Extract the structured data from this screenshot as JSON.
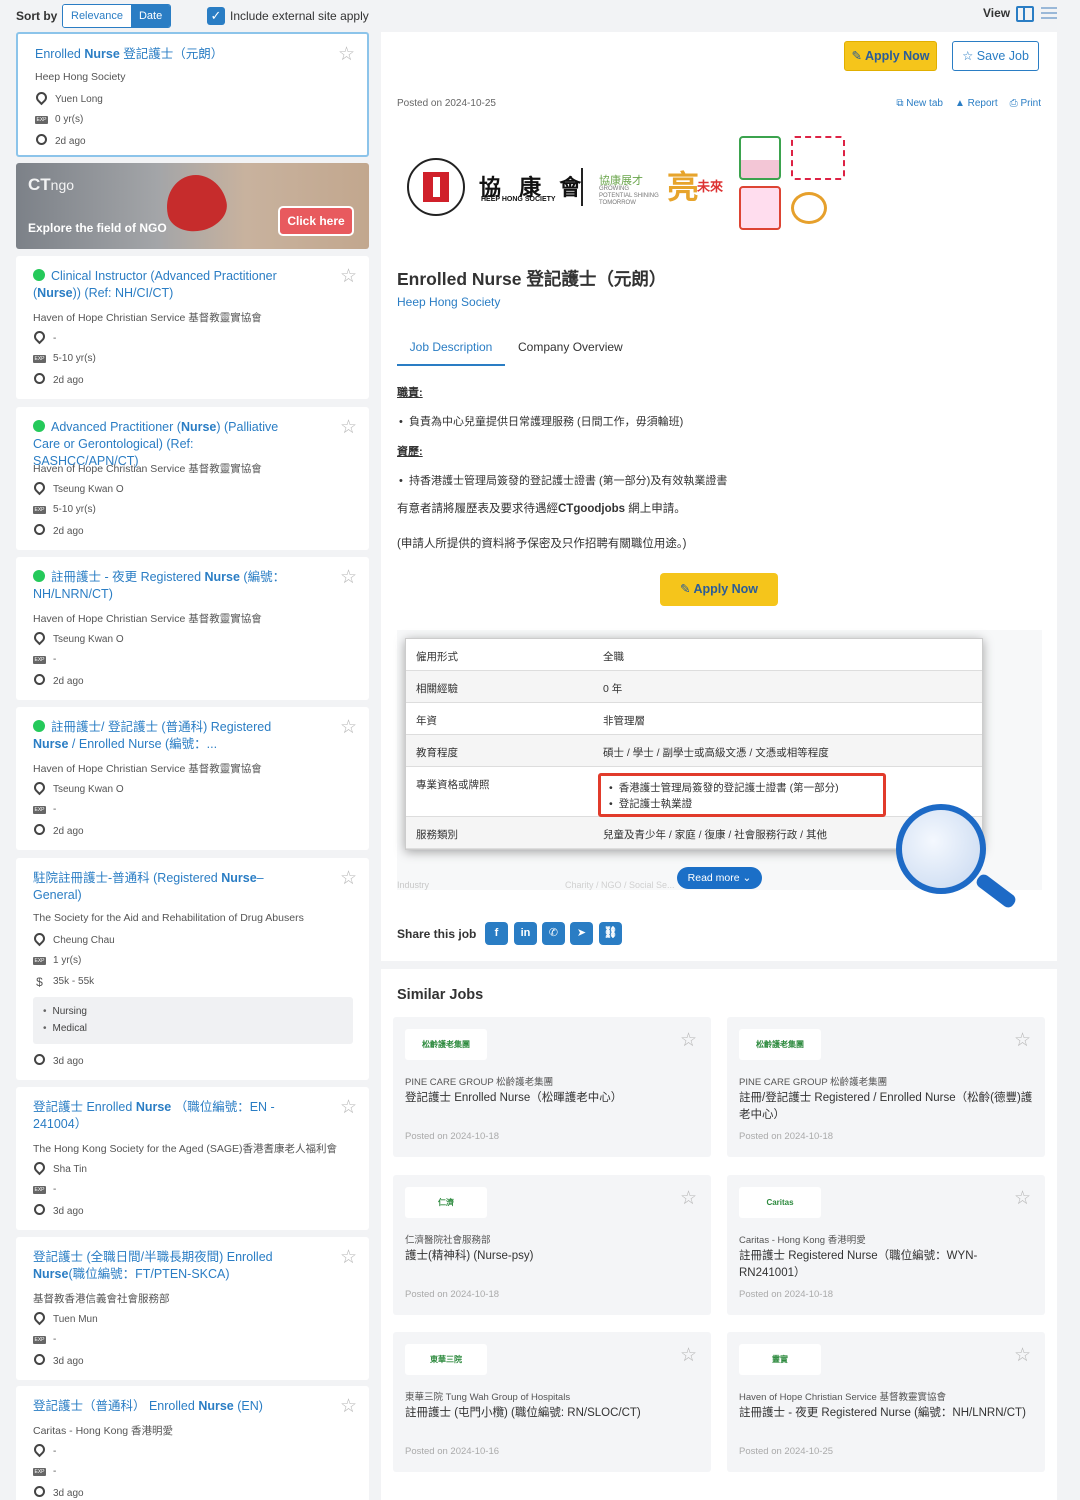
{
  "topbar": {
    "sort_label": "Sort by",
    "sort_options": [
      "Relevance",
      "Date"
    ],
    "include_label": "Include external site apply",
    "view_label": "View"
  },
  "jobs": [
    {
      "title_pre": "Enrolled ",
      "title_bold": "Nurse",
      "title_post": " 登記護士（元朗）",
      "company": "Heep Hong Society",
      "location": "Yuen Long",
      "exp": "0 yr(s)",
      "age": "2d ago"
    },
    {
      "title_pre": "Clinical Instructor (Advanced Practitioner (",
      "title_bold": "Nurse",
      "title_post": ")) (Ref: NH/CI/CT)",
      "company": "Haven of Hope Christian Service 基督教靈實協會",
      "location": "-",
      "exp": "5-10 yr(s)",
      "age": "2d ago"
    },
    {
      "title_pre": "Advanced Practitioner (",
      "title_bold": "Nurse",
      "title_post": ") (Palliative Care or Gerontological) (Ref: SASHCC/APN/CT)",
      "company": "Haven of Hope Christian Service 基督教靈實協會",
      "location": "Tseung Kwan O",
      "exp": "5-10 yr(s)",
      "age": "2d ago"
    },
    {
      "title_pre": "註冊護士 - 夜更 Registered ",
      "title_bold": "Nurse",
      "title_post": " (編號：NH/LNRN/CT)",
      "company": "Haven of Hope Christian Service 基督教靈實協會",
      "location": "Tseung Kwan O",
      "exp": "-",
      "age": "2d ago"
    },
    {
      "title_pre": "註冊護士/ 登記護士 (普通科) Registered ",
      "title_bold": "Nurse",
      "title_post": " / Enrolled Nurse (編號：...",
      "company": "Haven of Hope Christian Service 基督教靈實協會",
      "location": "Tseung Kwan O",
      "exp": "-",
      "age": "2d ago"
    },
    {
      "title_pre": "駐院註冊護士-普通科 (Registered ",
      "title_bold": "Nurse",
      "title_post": "–General)",
      "company": "The Society for the Aid and Rehabilitation of Drug Abusers",
      "location": "Cheung Chau",
      "exp": "1 yr(s)",
      "salary": "35k - 55k",
      "tags": [
        "Nursing",
        "Medical"
      ],
      "age": "3d ago"
    },
    {
      "title_pre": "登記護士 Enrolled ",
      "title_bold": "Nurse",
      "title_post": " （職位編號：EN - 241004）",
      "company": "The Hong Kong Society for the Aged (SAGE)香港耆康老人福利會",
      "location": "Sha Tin",
      "exp": "-",
      "age": "3d ago"
    },
    {
      "title_pre": "登記護士 (全職日間/半職長期夜間) Enrolled ",
      "title_bold": "Nurse",
      "title_post": "(職位編號：FT/PTEN-SKCA)",
      "company": "基督教香港信義會社會服務部",
      "location": "Tuen Mun",
      "exp": "-",
      "age": "3d ago"
    },
    {
      "title_pre": "登記護士（普通科） Enrolled ",
      "title_bold": "Nurse",
      "title_post": " (EN)",
      "company": "Caritas - Hong Kong 香港明愛",
      "location": "-",
      "exp": "-",
      "age": "3d ago"
    }
  ],
  "banner": {
    "logo": "CT",
    "logo_sub": "ngo",
    "text": "Explore the field of NGO",
    "button": "Click here"
  },
  "detail": {
    "apply_label": "Apply Now",
    "save_label": "Save Job",
    "posted": "Posted on 2024-10-25",
    "actions": [
      "New tab",
      "Report",
      "Print"
    ],
    "logo_name": "協 康 會",
    "logo_en": "HEEP HONG SOCIETY",
    "slogan": "協康展才",
    "slogan_en": "GROWING POTENTIAL SHINING TOMORROW",
    "slogan_big": "亮",
    "slogan_future": "未來",
    "title": "Enrolled Nurse 登記護士（元朗）",
    "company": "Heep Hong Society",
    "tabs": [
      "Job Description",
      "Company Overview"
    ],
    "duty_head": "職責:",
    "duty": "負責為中心兒童提供日常護理服務 (日間工作，毋須輪班)",
    "req_head": "資歷:",
    "req": "持香港護士管理局簽發的登記護士證書 (第一部分)及有效執業證書",
    "apply_note_pre": "有意者請將履歷表及要求待遇經",
    "apply_note_bold": "CTgoodjobs",
    "apply_note_post": " 網上申請。",
    "privacy": "(申請人所提供的資料將予保密及只作招聘有關職位用途。)",
    "table": [
      {
        "k": "僱用形式",
        "v": "全職"
      },
      {
        "k": "相關經驗",
        "v": "0 年"
      },
      {
        "k": "年資",
        "v": "非管理層"
      },
      {
        "k": "教育程度",
        "v": "碩士  /  學士  /  副學士或高級文憑  /  文憑或相等程度"
      },
      {
        "k": "專業資格或牌照",
        "v": ""
      },
      {
        "k": "服務類別",
        "v": "兒童及青少年  /  家庭  /  復康  /  社會服務行政  /  其他"
      }
    ],
    "licences": [
      "香港護士管理局簽發的登記護士證書 (第一部分)",
      "登記護士執業證"
    ],
    "faint_industry": "Industry",
    "faint_value": "Charity / NGO / Social Se...",
    "read_more": "Read more",
    "share_label": "Share this job"
  },
  "similar": {
    "header": "Similar Jobs",
    "items": [
      {
        "logo": "松齡護老集團",
        "company": "PINE CARE GROUP 松齡護老集團",
        "title": "登記護士 Enrolled Nurse（松暉護老中心）",
        "posted": "Posted on 2024-10-18"
      },
      {
        "logo": "松齡護老集團",
        "company": "PINE CARE GROUP 松齡護老集團",
        "title": "註冊/登記護士 Registered / Enrolled Nurse（松齡(德豐)護老中心）",
        "posted": "Posted on 2024-10-18"
      },
      {
        "logo": "仁濟",
        "company": "仁濟醫院社會服務部",
        "title": "護士(精神科) (Nurse-psy)",
        "posted": "Posted on 2024-10-18"
      },
      {
        "logo": "Caritas",
        "company": "Caritas - Hong Kong 香港明愛",
        "title": "註冊護士 Registered Nurse（職位編號：WYN-RN241001）",
        "posted": "Posted on 2024-10-18"
      },
      {
        "logo": "東華三院",
        "company": "東華三院 Tung Wah Group of Hospitals",
        "title": "註冊護士 (屯門小欖) (職位編號: RN/SLOC/CT)",
        "posted": "Posted on 2024-10-16"
      },
      {
        "logo": "靈實",
        "company": "Haven of Hope Christian Service 基督教靈實協會",
        "title": "註冊護士 - 夜更 Registered Nurse (編號：NH/LNRN/CT)",
        "posted": "Posted on 2024-10-25"
      }
    ]
  }
}
